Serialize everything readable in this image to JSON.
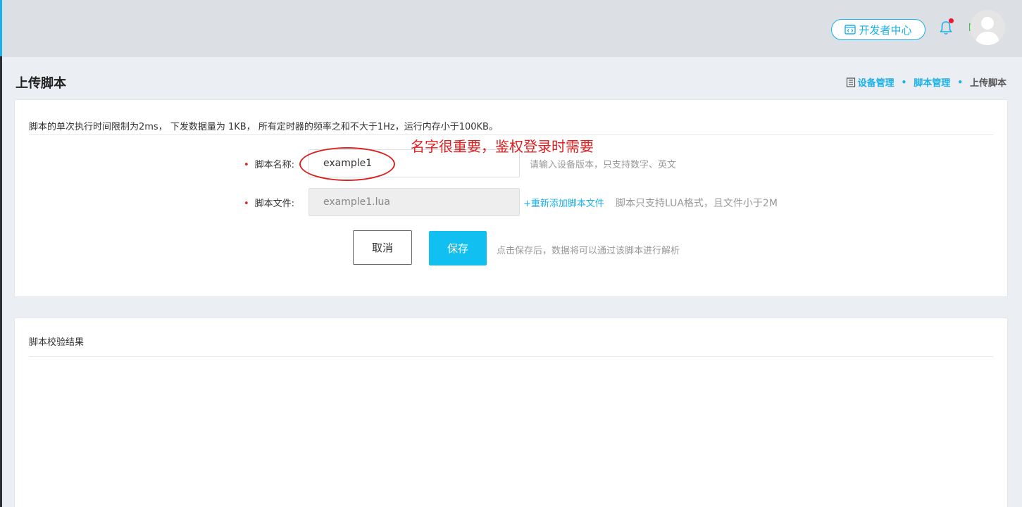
{
  "header": {
    "dev_center_label": "开发者中心",
    "has_notification": true
  },
  "page": {
    "title": "上传脚本",
    "breadcrumb": [
      "设备管理",
      "脚本管理",
      "上传脚本"
    ]
  },
  "upload_form": {
    "notice": "脚本的单次执行时间限制为2ms， 下发数据量为 1KB， 所有定时器的频率之和不大于1Hz，运行内存小于100KB。",
    "required_mark": "•",
    "name_label": "脚本名称:",
    "name_value": "example1",
    "name_hint": "请输入设备版本，只支持数字、英文",
    "file_label": "脚本文件:",
    "file_value": "example1.lua",
    "add_file_link": "+重新添加脚本文件",
    "file_hint": "脚本只支持LUA格式，且文件小于2M",
    "cancel_label": "取消",
    "save_label": "保存",
    "save_hint": "点击保存后，数据将可以通过该脚本进行解析"
  },
  "annotation": {
    "text": "名字很重要，鉴权登录时需要",
    "color": "#e02020"
  },
  "result_panel": {
    "title": "脚本校验结果"
  },
  "colors": {
    "accent": "#1ab0e8",
    "save_button": "#11bff0",
    "required": "#e02020"
  }
}
